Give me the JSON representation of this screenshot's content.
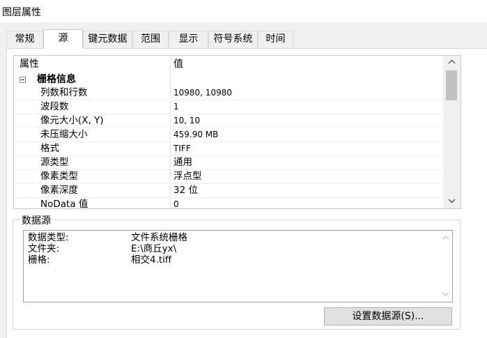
{
  "window": {
    "title": "图层属性"
  },
  "tabs": [
    {
      "label": "常规"
    },
    {
      "label": "源",
      "active": true
    },
    {
      "label": "键元数据"
    },
    {
      "label": "范围"
    },
    {
      "label": "显示"
    },
    {
      "label": "符号系统"
    },
    {
      "label": "时间"
    }
  ],
  "grid": {
    "headers": {
      "property": "属性",
      "value": "值"
    },
    "group": {
      "label": "栅格信息"
    },
    "rows": [
      {
        "name": "列数和行数",
        "value": "10980, 10980"
      },
      {
        "name": "波段数",
        "value": "1"
      },
      {
        "name": "像元大小(X, Y)",
        "value": "10, 10"
      },
      {
        "name": "未压缩大小",
        "value": "459.90 MB"
      },
      {
        "name": "格式",
        "value": "TIFF"
      },
      {
        "name": "源类型",
        "value": "通用"
      },
      {
        "name": "像素类型",
        "value": "浮点型"
      },
      {
        "name": "像素深度",
        "value": "32 位"
      },
      {
        "name": "NoData 值",
        "value": "0"
      }
    ],
    "scroll_up_icon": "chevron-up-icon",
    "scroll_down_icon": "chevron-down-icon"
  },
  "datasource": {
    "title": "数据源",
    "lines": [
      {
        "key": "数据类型:",
        "value": "文件系统栅格"
      },
      {
        "key": "文件夹:",
        "value": "E:\\商丘yx\\"
      },
      {
        "key": "栅格:",
        "value": "相交4.tiff"
      }
    ],
    "button_label": "设置数据源(S)..."
  }
}
